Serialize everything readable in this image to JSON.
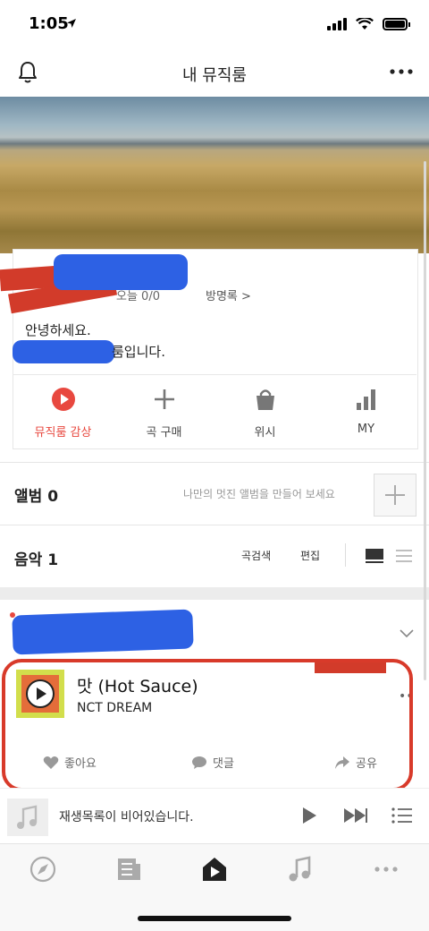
{
  "status_bar": {
    "time": "1:05"
  },
  "header": {
    "title": "내 뮤직룸"
  },
  "profile": {
    "stats": "오늘 0/0",
    "guestbook_link": "방명록 >",
    "greeting_line1": "안녕하세요.",
    "greeting_line2": "룸입니다."
  },
  "actions": [
    {
      "label": "뮤직룸 감상",
      "icon": "play-circle-icon",
      "color": "#e8483f"
    },
    {
      "label": "곡 구매",
      "icon": "plus-icon"
    },
    {
      "label": "위시",
      "icon": "shopping-bag-icon"
    },
    {
      "label": "MY",
      "icon": "bar-chart-icon"
    }
  ],
  "albums": {
    "title": "앨범 0",
    "hint": "나만의 멋진 앨범을 만들어 보세요"
  },
  "music": {
    "title": "음악 1",
    "search_label": "곡검색",
    "edit_label": "편집"
  },
  "post": {
    "song_title": "맛 (Hot Sauce)",
    "artist": "NCT DREAM",
    "like_label": "좋아요",
    "comment_label": "댓글",
    "share_label": "공유"
  },
  "player": {
    "empty_text": "재생목록이 비어있습니다."
  },
  "tabbar": [
    "compass-icon",
    "news-icon",
    "music-room-icon",
    "music-note-icon",
    "more-icon"
  ],
  "colors": {
    "accent": "#e8483f",
    "annotation": "#d83a2a",
    "redaction_blue": "#2d61e4"
  }
}
